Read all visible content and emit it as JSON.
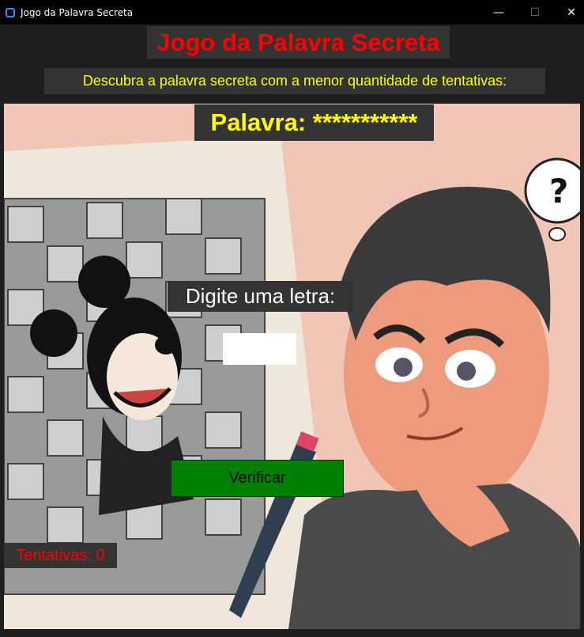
{
  "window": {
    "title": "Jogo da Palavra Secreta",
    "controls": {
      "minimize": "—",
      "maximize": "☐",
      "close": "✕"
    }
  },
  "header": {
    "title": "Jogo da Palavra Secreta",
    "subtitle": "Descubra a palavra secreta com a menor quantidade de tentativas:"
  },
  "game": {
    "word_label": "Palavra: ***********",
    "prompt": "Digite uma letra:",
    "letter_input_value": "",
    "verify_button": "Verificar",
    "attempts_label": "Tentativas: 0",
    "background_image": "illustration-man-thinking-with-mickey-puzzle"
  },
  "colors": {
    "title": "#ff0000",
    "subtitle": "#ffff00",
    "word": "#ffff00",
    "button": "#008000",
    "attempts": "#ff0000",
    "label_bg": "#333333"
  }
}
